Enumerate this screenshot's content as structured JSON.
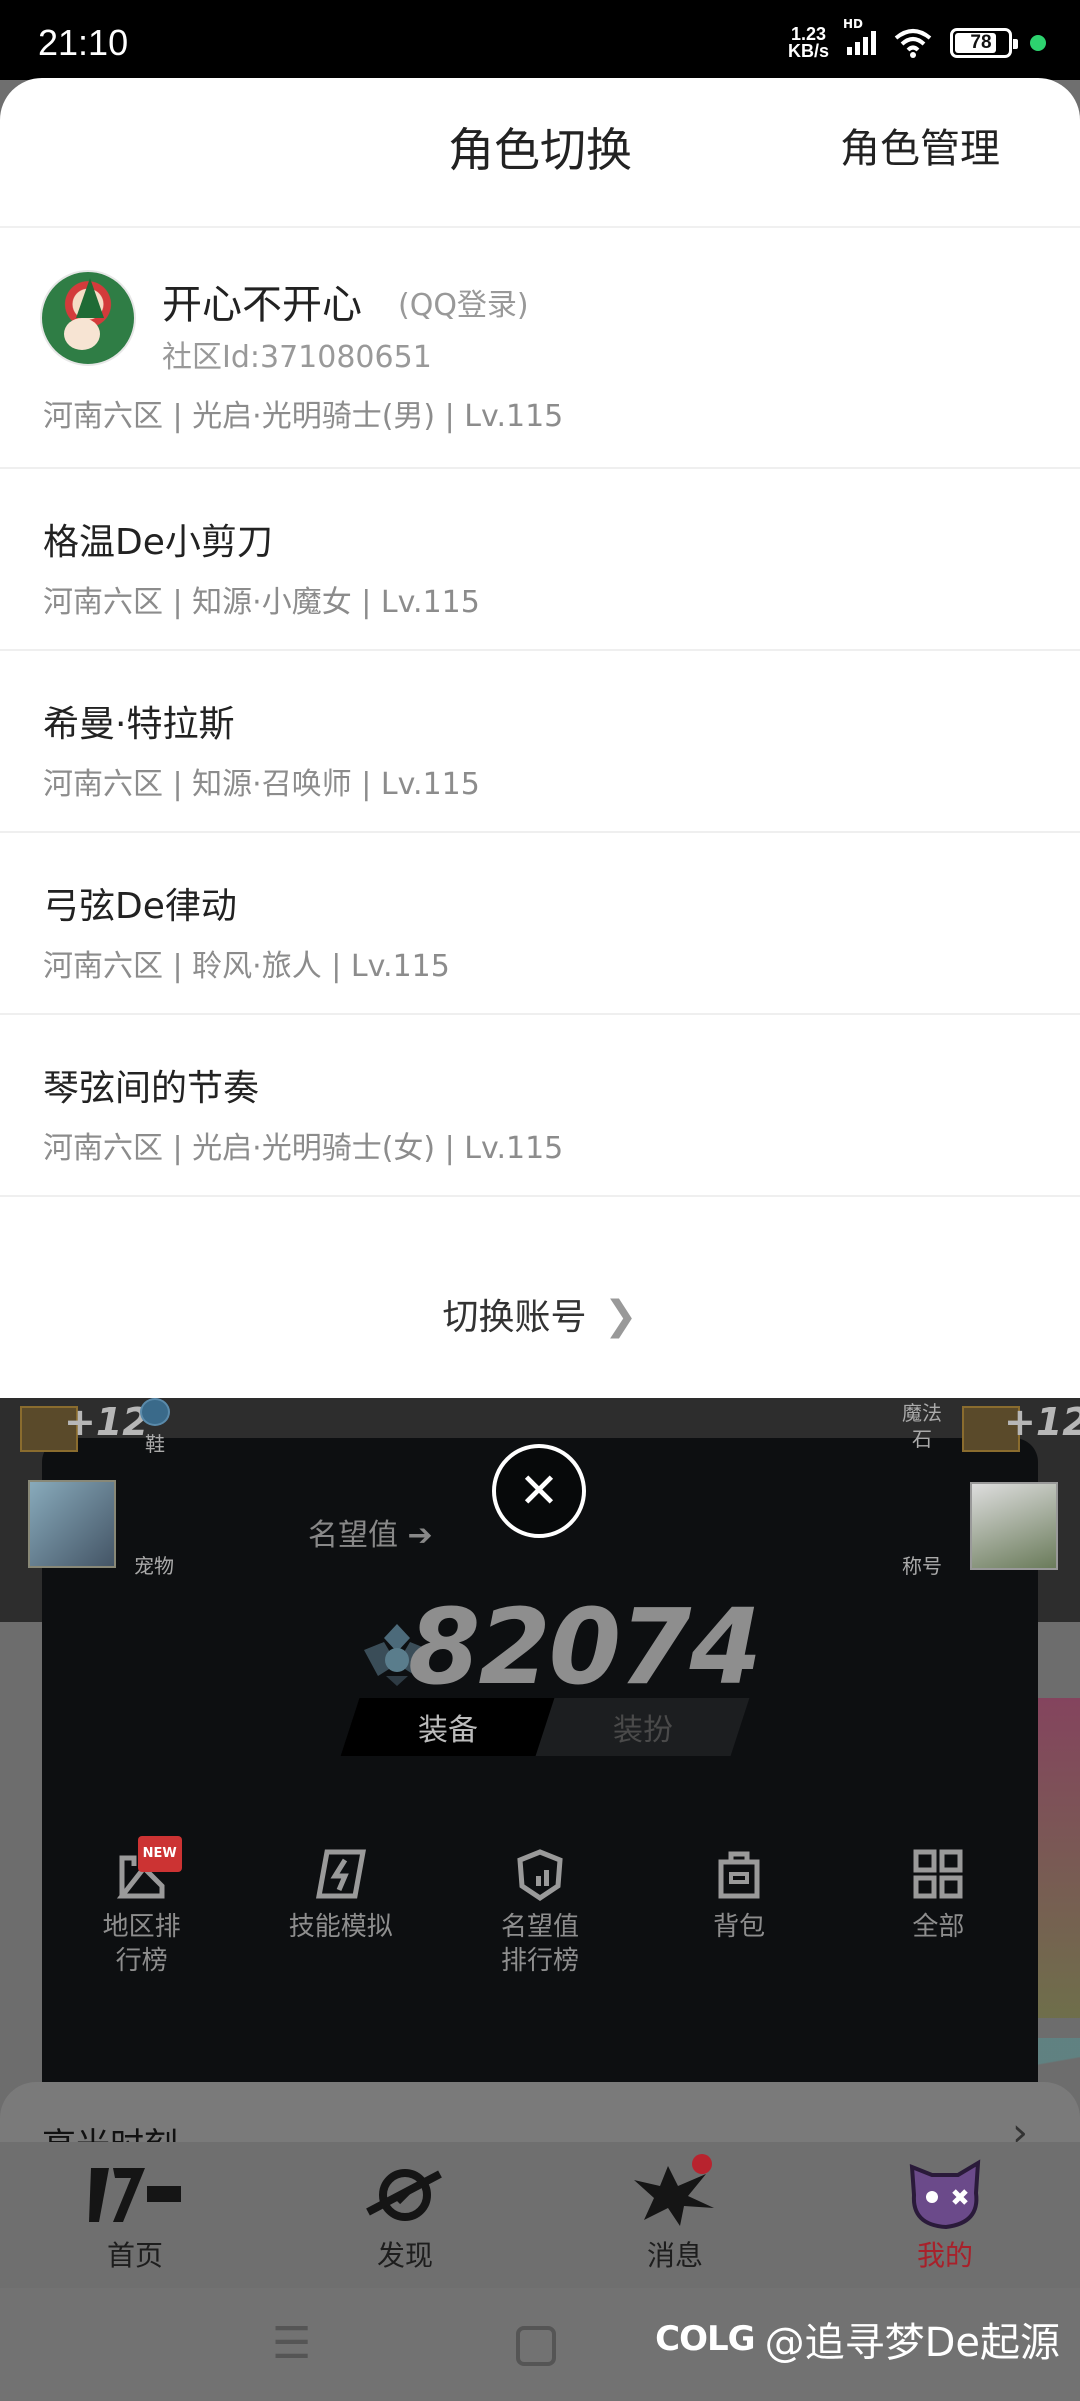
{
  "status_bar": {
    "time": "21:10",
    "net_speed_value": "1.23",
    "net_speed_unit": "KB/s",
    "network_badge": "HD",
    "battery_level": 78,
    "battery_text": "78",
    "dot_color": "#2dd36f"
  },
  "sheet": {
    "title": "角色切换",
    "manage_label": "角色管理",
    "account": {
      "name": "开心不开心",
      "login_type": "(QQ登录)",
      "community_id": "社区Id:371080651"
    },
    "partial_role_detail": "河南六区 | 光启·光明骑士(男) | Lv.115",
    "roles": [
      {
        "name": "格温De小剪刀",
        "detail": "河南六区 | 知源·小魔女 | Lv.115"
      },
      {
        "name": "希曼·特拉斯",
        "detail": "河南六区 | 知源·召唤师 | Lv.115"
      },
      {
        "name": "弓弦De律动",
        "detail": "河南六区 | 聆风·旅人 | Lv.115"
      },
      {
        "name": "琴弦间的节奏",
        "detail": "河南六区 | 光启·光明骑士(女) | Lv.115"
      }
    ],
    "switch_account_label": "切换账号",
    "switch_account_chevron": "❯"
  },
  "background": {
    "left_plus": "+12",
    "right_plus": "+12",
    "shoe_label": "鞋",
    "magic_stone_label_1": "魔法",
    "magic_stone_label_2": "石",
    "pet_label": "宠物",
    "title_label": "称号",
    "close_symbol": "✕",
    "fame_label": "名望值 ➔",
    "fame_value": "82074",
    "tabs": [
      "装备",
      "装扮"
    ],
    "active_tab_index": 0,
    "shortcuts": [
      {
        "label_1": "地区排",
        "label_2": "行榜",
        "icon": "ranking-icon",
        "badge": "NEW"
      },
      {
        "label_1": "技能模拟",
        "label_2": "",
        "icon": "skill-sim-icon"
      },
      {
        "label_1": "名望值",
        "label_2": "排行榜",
        "icon": "fame-rank-icon"
      },
      {
        "label_1": "背包",
        "label_2": "",
        "icon": "bag-icon"
      },
      {
        "label_1": "全部",
        "label_2": "",
        "icon": "grid-icon"
      }
    ],
    "highlight_title": "高光时刻",
    "highlight_arrow": "›",
    "bottom_tabs": [
      {
        "label": "首页",
        "icon": "home-logo-icon"
      },
      {
        "label": "发现",
        "icon": "discover-icon"
      },
      {
        "label": "消息",
        "icon": "message-icon"
      },
      {
        "label": "我的",
        "icon": "profile-icon"
      }
    ],
    "active_bottom_tab_index": 3,
    "accent_color": "#a8202a",
    "watermark_logo": "COLG",
    "watermark_text": "@追寻梦De起源"
  }
}
